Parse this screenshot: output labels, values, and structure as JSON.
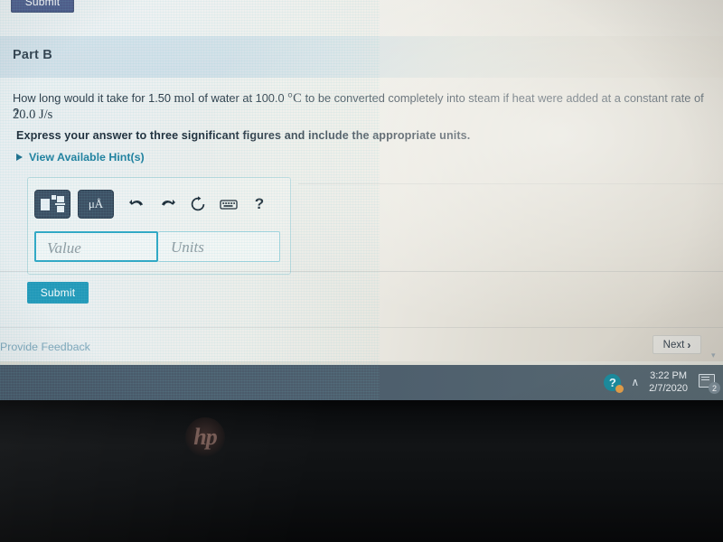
{
  "top_partial_button": {
    "label": "Submit"
  },
  "part": {
    "title": "Part B",
    "question_main": "How long would it take for 1.50 ",
    "question_mol": "mol",
    "question_mid": " of water at 100.0 ",
    "question_degc": "°C",
    "question_mid2": " to be converted completely into steam if heat were added at a constant rate of ",
    "question_rate": "20.0 J/s",
    "question_tail": "?",
    "instruction": "Express your answer to three significant figures and include the appropriate units.",
    "hints_label": "View Available Hint(s)"
  },
  "answer": {
    "toolbar": {
      "template_icon": "math-template-icon",
      "units_label": "μÅ",
      "undo_icon": "undo-arrow-icon",
      "redo_icon": "redo-arrow-icon",
      "reset_icon": "reset-circular-arrow-icon",
      "keyboard_icon": "keyboard-icon",
      "help_label": "?"
    },
    "value_placeholder": "Value",
    "units_placeholder": "Units",
    "submit_label": "Submit"
  },
  "footer": {
    "feedback_label": "Provide Feedback",
    "next_label": "Next",
    "next_chevron": "›"
  },
  "taskbar": {
    "help_icon_label": "?",
    "show_hidden_chevron": "∧",
    "time": "3:22 PM",
    "date": "2/7/2020",
    "notification_count": "2"
  },
  "device": {
    "brand": "hp"
  },
  "colors": {
    "accent_teal": "#2299b9",
    "link_teal": "#1d7f9e",
    "header_band": "#cfdde6",
    "taskbar": "#4c5d6c",
    "top_button_blue": "#2c3e75"
  }
}
